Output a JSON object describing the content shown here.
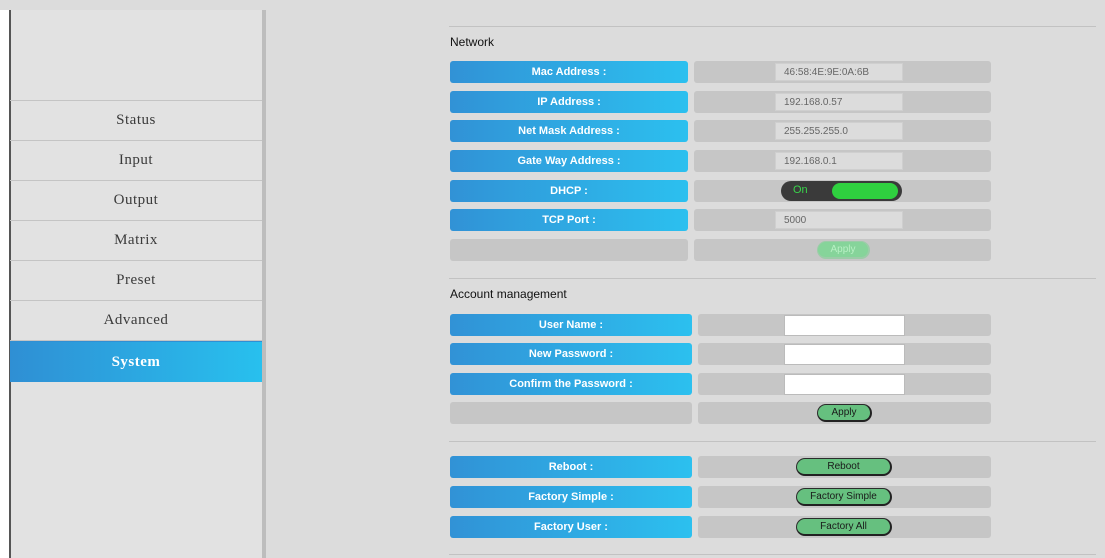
{
  "sidebar": {
    "items": [
      {
        "label": "Status"
      },
      {
        "label": "Input"
      },
      {
        "label": "Output"
      },
      {
        "label": "Matrix"
      },
      {
        "label": "Preset"
      },
      {
        "label": "Advanced"
      },
      {
        "label": "System",
        "active": true
      }
    ]
  },
  "network": {
    "title": "Network",
    "mac_label": "Mac Address :",
    "mac_value": "46:58:4E:9E:0A:6B",
    "ip_label": "IP Address :",
    "ip_value": "192.168.0.57",
    "mask_label": "Net Mask Address :",
    "mask_value": "255.255.255.0",
    "gateway_label": "Gate Way Address :",
    "gateway_value": "192.168.0.1",
    "dhcp_label": "DHCP :",
    "dhcp_state": "On",
    "tcp_label": "TCP Port :",
    "tcp_value": "5000",
    "apply_label": "Apply"
  },
  "account": {
    "title": "Account management",
    "username_label": "User Name :",
    "username_value": "",
    "new_password_label": "New Password :",
    "new_password_value": "",
    "confirm_password_label": "Confirm the Password :",
    "confirm_password_value": "",
    "apply_label": "Apply"
  },
  "system": {
    "reboot_label": "Reboot :",
    "reboot_button": "Reboot",
    "factory_simple_label": "Factory Simple :",
    "factory_simple_button": "Factory Simple",
    "factory_user_label": "Factory User :",
    "factory_user_button": "Factory All"
  },
  "colors": {
    "accent_start": "#3192d6",
    "accent_end": "#2cc0ef",
    "button_green": "#66c07f",
    "toggle_on": "#2fd03f"
  }
}
